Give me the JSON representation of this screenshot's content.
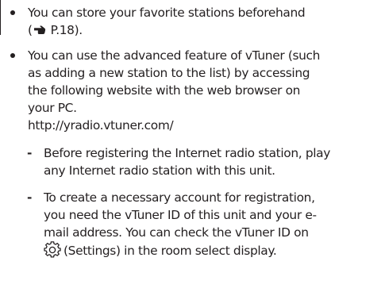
{
  "items": [
    {
      "lines": [
        "You can store your favorite stations beforehand",
        "P.18)."
      ],
      "open_paren": "("
    },
    {
      "lines": [
        "You can use the advanced feature of vTuner (such",
        "as adding a new station to the list) by accessing",
        "the following website with the web browser on",
        "your PC.",
        "http://yradio.vtuner.com/"
      ],
      "subitems": [
        {
          "marker": "-",
          "lines": [
            "Before registering the Internet radio station, play",
            "any Internet radio station with this unit."
          ]
        },
        {
          "marker": "-",
          "lines": [
            "To create a necessary account for registration,",
            "you need the vTuner ID of this unit and your e-",
            "mail address. You can check the vTuner ID on",
            "(Settings) in the room select display."
          ]
        }
      ]
    }
  ],
  "icons": {
    "page_ref": "pointing-hand-icon",
    "settings": "gear-icon"
  }
}
